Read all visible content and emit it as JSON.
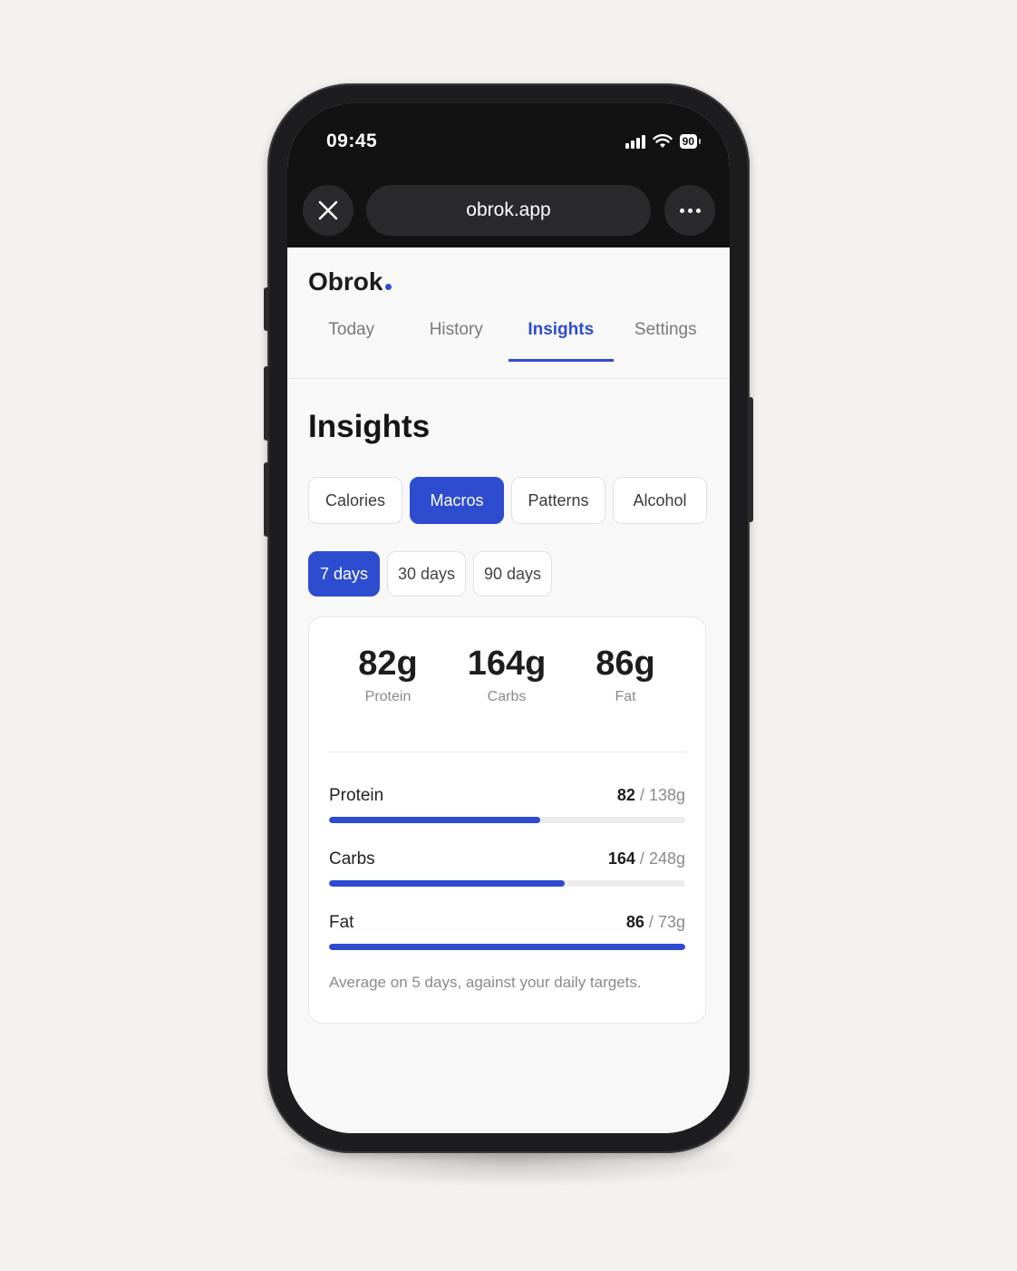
{
  "status_bar": {
    "time": "09:45",
    "battery": "90"
  },
  "browser": {
    "url": "obrok.app"
  },
  "app": {
    "brand": "Obrok"
  },
  "tabs": [
    {
      "label": "Today",
      "active": false
    },
    {
      "label": "History",
      "active": false
    },
    {
      "label": "Insights",
      "active": true
    },
    {
      "label": "Settings",
      "active": false
    }
  ],
  "page_title": "Insights",
  "categories": [
    {
      "label": "Calories",
      "active": false
    },
    {
      "label": "Macros",
      "active": true
    },
    {
      "label": "Patterns",
      "active": false
    },
    {
      "label": "Alcohol",
      "active": false
    }
  ],
  "ranges": [
    {
      "label": "7 days",
      "active": true
    },
    {
      "label": "30 days",
      "active": false
    },
    {
      "label": "90 days",
      "active": false
    }
  ],
  "summary": [
    {
      "value": "82g",
      "label": "Protein"
    },
    {
      "value": "164g",
      "label": "Carbs"
    },
    {
      "value": "86g",
      "label": "Fat"
    }
  ],
  "macros": [
    {
      "name": "Protein",
      "current": "82",
      "target": "138g",
      "progress": 0.594
    },
    {
      "name": "Carbs",
      "current": "164",
      "target": "248g",
      "progress": 0.661
    },
    {
      "name": "Fat",
      "current": "86",
      "target": "73g",
      "progress": 1.0
    }
  ],
  "separator": "/",
  "note": "Average on 5 days, against your daily targets.",
  "colors": {
    "accent": "#2d4ccf",
    "chrome": "#121212",
    "background": "#f4f2ef"
  }
}
